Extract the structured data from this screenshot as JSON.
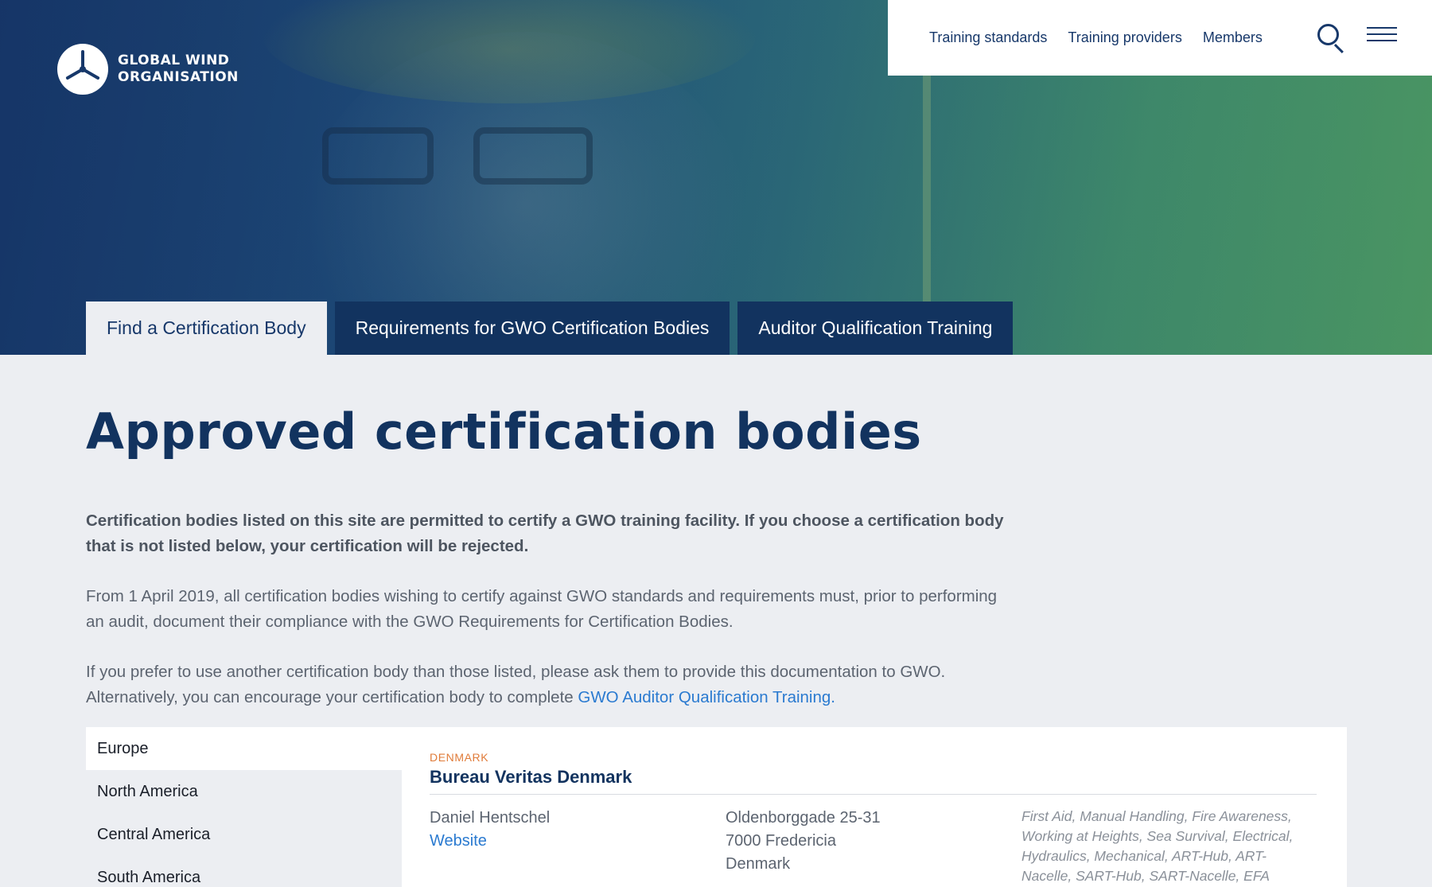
{
  "brand": {
    "line1": "GLOBAL WIND",
    "line2": "ORGANISATION"
  },
  "nav": {
    "items": [
      "Training standards",
      "Training providers",
      "Members"
    ],
    "search_icon": "search-icon",
    "menu_icon": "hamburger-menu-icon"
  },
  "tabs": [
    {
      "label": "Find a Certification Body",
      "active": true
    },
    {
      "label": "Requirements for GWO Certification Bodies",
      "active": false
    },
    {
      "label": "Auditor Qualification Training",
      "active": false
    }
  ],
  "page": {
    "title": "Approved certification bodies",
    "lead": "Certification bodies listed on this site are permitted to certify a GWO training facility. If you choose a certification body that is not listed below, your certification will be rejected.",
    "para1": "From 1 April 2019, all certification bodies wishing to certify against GWO standards and requirements must, prior to performing an audit, document their compliance with the GWO Requirements for Certification Bodies.",
    "para2_text": "If you prefer to use another certification body than those listed, please ask them to provide this documentation to GWO. Alternatively, you can encourage your certification body to complete",
    "para2_link": "GWO Auditor Qualification Training."
  },
  "regions": [
    {
      "label": "Europe",
      "active": true
    },
    {
      "label": "North America",
      "active": false
    },
    {
      "label": "Central America",
      "active": false
    },
    {
      "label": "South America",
      "active": false
    }
  ],
  "entry": {
    "country": "DENMARK",
    "name": "Bureau Veritas Denmark",
    "contact": "Daniel Hentschel",
    "website_label": "Website",
    "address1": "Oldenborggade 25-31",
    "address2": "7000  Fredericia",
    "address3": "Denmark",
    "modules": "First Aid, Manual Handling, Fire Awareness, Working at Heights, Sea Survival, Electrical, Hydraulics, Mechanical, ART-Hub, ART-Nacelle, SART-Hub, SART-Nacelle, EFA"
  },
  "colors": {
    "navy": "#12335f",
    "link": "#2a7ad0",
    "country_accent": "#e07b39",
    "page_bg": "#eceef2"
  }
}
